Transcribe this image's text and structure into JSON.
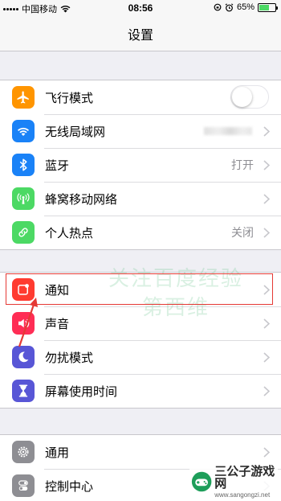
{
  "status_bar": {
    "carrier": "中国移动",
    "time": "08:56",
    "battery": "65%",
    "battery_level": 0.65
  },
  "nav": {
    "title": "设置"
  },
  "groups": [
    {
      "rows": [
        {
          "label": "飞行模式",
          "icon": "airplane-icon",
          "icon_color": "#ff9500",
          "accessory": "toggle",
          "toggle_on": false
        },
        {
          "label": "无线局域网",
          "icon": "wifi-icon",
          "icon_color": "#1a82f7",
          "accessory": "blurred-value"
        },
        {
          "label": "蓝牙",
          "icon": "bluetooth-icon",
          "icon_color": "#1a82f7",
          "accessory": "value",
          "value": "打开"
        },
        {
          "label": "蜂窝移动网络",
          "icon": "cellular-icon",
          "icon_color": "#4cd964",
          "accessory": "chevron"
        },
        {
          "label": "个人热点",
          "icon": "hotspot-icon",
          "icon_color": "#4cd964",
          "accessory": "value",
          "value": "关闭"
        }
      ]
    },
    {
      "rows": [
        {
          "label": "通知",
          "icon": "notifications-icon",
          "icon_color": "#ff3b30",
          "accessory": "chevron"
        },
        {
          "label": "声音",
          "icon": "sound-icon",
          "icon_color": "#ff2d55",
          "accessory": "chevron"
        },
        {
          "label": "勿扰模式",
          "icon": "moon-icon",
          "icon_color": "#5856d6",
          "accessory": "chevron"
        },
        {
          "label": "屏幕使用时间",
          "icon": "hourglass-icon",
          "icon_color": "#5856d6",
          "accessory": "chevron"
        }
      ]
    },
    {
      "rows": [
        {
          "label": "通用",
          "icon": "gear-icon",
          "icon_color": "#8e8e93",
          "accessory": "chevron"
        },
        {
          "label": "控制中心",
          "icon": "toggles-icon",
          "icon_color": "#8e8e93",
          "accessory": "chevron"
        }
      ]
    }
  ],
  "watermark": {
    "line1": "关注百度经验",
    "line2": "第西维"
  },
  "logo": {
    "title": "三公子游戏网",
    "url": "www.sangongzi.net"
  },
  "colors": {
    "highlight": "#e53935",
    "background": "#efeff4"
  }
}
